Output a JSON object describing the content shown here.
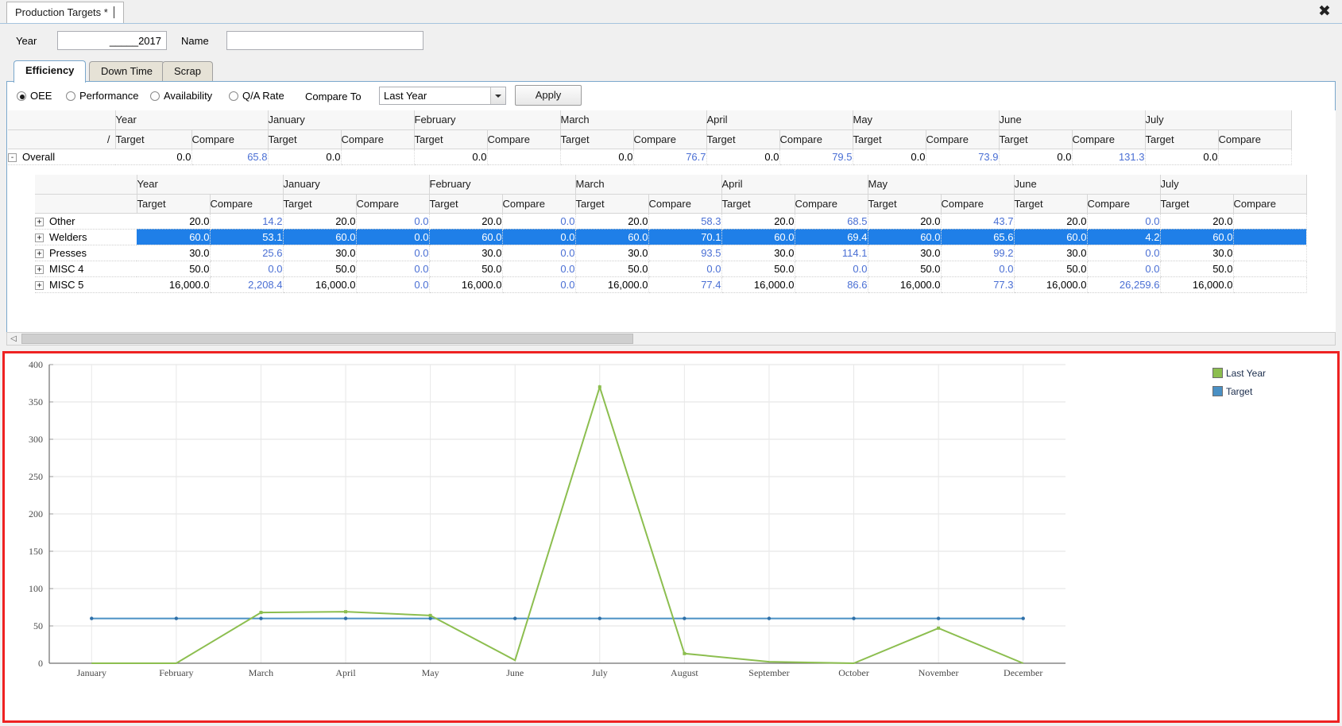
{
  "window": {
    "doc_tab_title": "Production Targets *",
    "close_icon": "close-icon"
  },
  "form": {
    "year_label": "Year",
    "year_value": "_____2017",
    "name_label": "Name",
    "name_value": "",
    "name_placeholder": ""
  },
  "tabs": [
    {
      "label": "Efficiency",
      "active": true
    },
    {
      "label": "Down Time",
      "active": false
    },
    {
      "label": "Scrap",
      "active": false
    }
  ],
  "options": {
    "radios": [
      {
        "label": "OEE",
        "selected": true
      },
      {
        "label": "Performance",
        "selected": false
      },
      {
        "label": "Availability",
        "selected": false
      },
      {
        "label": "Q/A Rate",
        "selected": false
      }
    ],
    "compare_to_label": "Compare To",
    "compare_to_value": "Last Year",
    "compare_to_options": [
      "Last Year"
    ],
    "apply_label": "Apply"
  },
  "grid": {
    "group_headers": [
      "Year",
      "January",
      "February",
      "March",
      "April",
      "May",
      "June",
      "July"
    ],
    "sub_headers": [
      "Target",
      "Compare"
    ],
    "corner_label": "/",
    "overall": {
      "name": "Overall",
      "expander": "-",
      "cells": [
        {
          "target": "0.0",
          "compare": "65.8"
        },
        {
          "target": "0.0",
          "compare": ""
        },
        {
          "target": "0.0",
          "compare": ""
        },
        {
          "target": "0.0",
          "compare": "76.7"
        },
        {
          "target": "0.0",
          "compare": "79.5"
        },
        {
          "target": "0.0",
          "compare": "73.9"
        },
        {
          "target": "0.0",
          "compare": "131.3"
        },
        {
          "target": "0.0",
          "compare": ""
        }
      ]
    },
    "rows": [
      {
        "name": "Other",
        "expander": "+",
        "selected": false,
        "cells": [
          {
            "target": "20.0",
            "compare": "14.2"
          },
          {
            "target": "20.0",
            "compare": "0.0"
          },
          {
            "target": "20.0",
            "compare": "0.0"
          },
          {
            "target": "20.0",
            "compare": "58.3"
          },
          {
            "target": "20.0",
            "compare": "68.5"
          },
          {
            "target": "20.0",
            "compare": "43.7"
          },
          {
            "target": "20.0",
            "compare": "0.0"
          },
          {
            "target": "20.0",
            "compare": ""
          }
        ]
      },
      {
        "name": "Welders",
        "expander": "+",
        "selected": true,
        "cells": [
          {
            "target": "60.0",
            "compare": "53.1"
          },
          {
            "target": "60.0",
            "compare": "0.0"
          },
          {
            "target": "60.0",
            "compare": "0.0"
          },
          {
            "target": "60.0",
            "compare": "70.1"
          },
          {
            "target": "60.0",
            "compare": "69.4"
          },
          {
            "target": "60.0",
            "compare": "65.6"
          },
          {
            "target": "60.0",
            "compare": "4.2"
          },
          {
            "target": "60.0",
            "compare": ""
          }
        ]
      },
      {
        "name": "Presses",
        "expander": "+",
        "selected": false,
        "cells": [
          {
            "target": "30.0",
            "compare": "25.6"
          },
          {
            "target": "30.0",
            "compare": "0.0"
          },
          {
            "target": "30.0",
            "compare": "0.0"
          },
          {
            "target": "30.0",
            "compare": "93.5"
          },
          {
            "target": "30.0",
            "compare": "114.1"
          },
          {
            "target": "30.0",
            "compare": "99.2"
          },
          {
            "target": "30.0",
            "compare": "0.0"
          },
          {
            "target": "30.0",
            "compare": ""
          }
        ]
      },
      {
        "name": "MISC 4",
        "expander": "+",
        "selected": false,
        "cells": [
          {
            "target": "50.0",
            "compare": "0.0"
          },
          {
            "target": "50.0",
            "compare": "0.0"
          },
          {
            "target": "50.0",
            "compare": "0.0"
          },
          {
            "target": "50.0",
            "compare": "0.0"
          },
          {
            "target": "50.0",
            "compare": "0.0"
          },
          {
            "target": "50.0",
            "compare": "0.0"
          },
          {
            "target": "50.0",
            "compare": "0.0"
          },
          {
            "target": "50.0",
            "compare": ""
          }
        ]
      },
      {
        "name": "MISC 5",
        "expander": "+",
        "selected": false,
        "cells": [
          {
            "target": "16,000.0",
            "compare": "2,208.4"
          },
          {
            "target": "16,000.0",
            "compare": "0.0"
          },
          {
            "target": "16,000.0",
            "compare": "0.0"
          },
          {
            "target": "16,000.0",
            "compare": "77.4"
          },
          {
            "target": "16,000.0",
            "compare": "86.6"
          },
          {
            "target": "16,000.0",
            "compare": "77.3"
          },
          {
            "target": "16,000.0",
            "compare": "26,259.6"
          },
          {
            "target": "16,000.0",
            "compare": ""
          }
        ]
      }
    ]
  },
  "scrollbar": {
    "left_arrow": "chevron-left-icon"
  },
  "chart_data": {
    "type": "line",
    "title": "",
    "xlabel": "",
    "ylabel": "",
    "categories": [
      "January",
      "February",
      "March",
      "April",
      "May",
      "June",
      "July",
      "August",
      "September",
      "October",
      "November",
      "December"
    ],
    "yticks": [
      0,
      50,
      100,
      150,
      200,
      250,
      300,
      350,
      400
    ],
    "ylim": [
      0,
      400
    ],
    "grid": true,
    "legend_position": "right",
    "series": [
      {
        "name": "Last Year",
        "color": "#8cbe4f",
        "values": [
          0,
          0,
          68,
          69,
          64,
          4,
          370,
          13,
          2,
          0,
          47,
          0
        ]
      },
      {
        "name": "Target",
        "color": "#4a90c4",
        "values": [
          60,
          60,
          60,
          60,
          60,
          60,
          60,
          60,
          60,
          60,
          60,
          60
        ]
      }
    ]
  }
}
